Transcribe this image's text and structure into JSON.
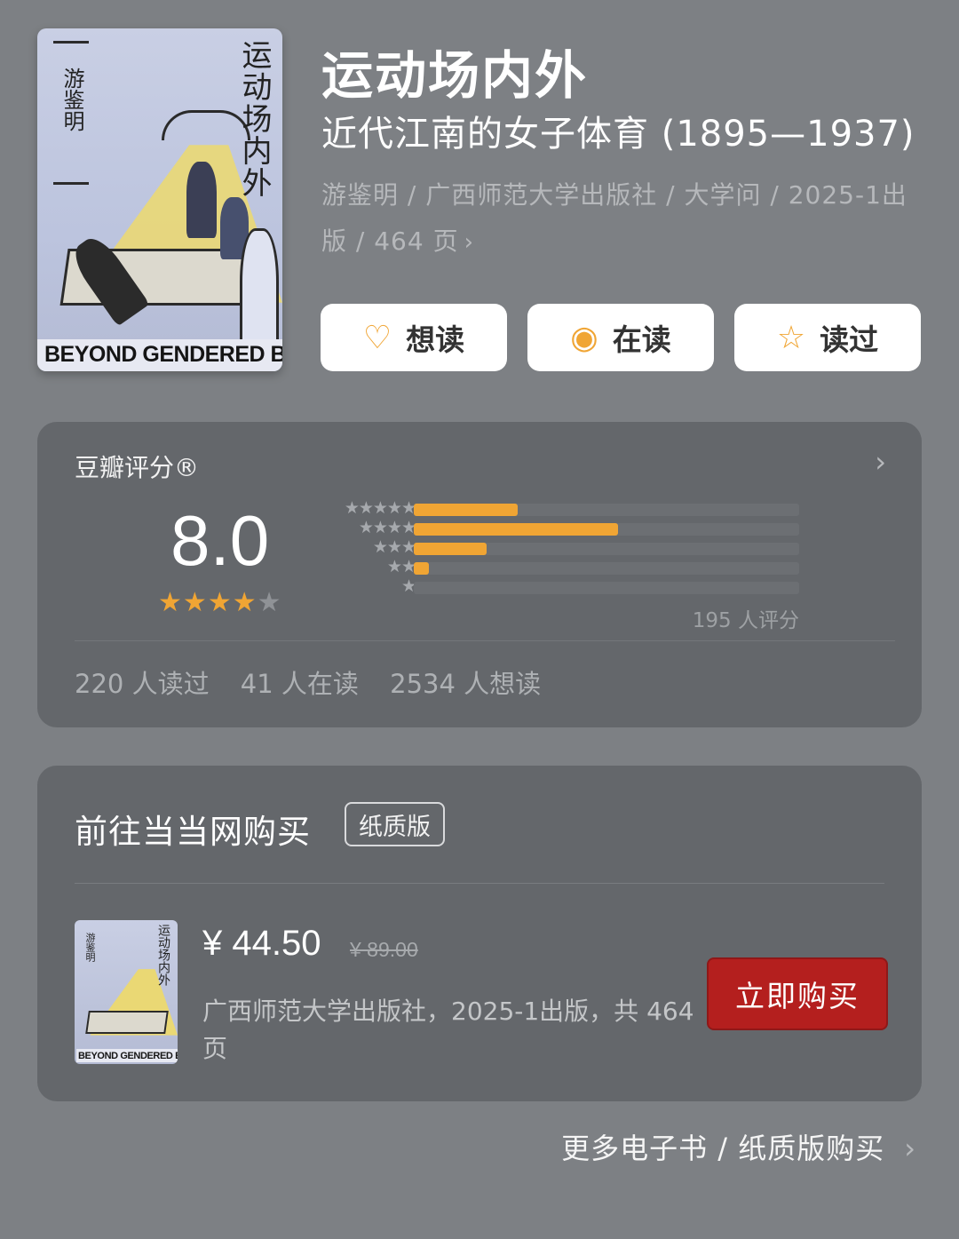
{
  "book": {
    "title": "运动场内外",
    "subtitle": "近代江南的女子体育 (1895—1937)",
    "meta": "游鉴明 / 广西师范大学出版社 / 大学问 / 2025-1出版 / 464 页",
    "cover": {
      "author_vertical": "游鉴明",
      "title_vertical": "运动场内外",
      "english_text": "BEYOND GENDERED BO"
    }
  },
  "actions": {
    "want": {
      "label": "想读",
      "icon": "heart-plus-icon"
    },
    "reading": {
      "label": "在读",
      "icon": "target-icon"
    },
    "read": {
      "label": "读过",
      "icon": "star-outline-icon"
    }
  },
  "rating": {
    "label": "豆瓣评分®",
    "score": "8.0",
    "stars_filled": 4,
    "stars_total": 5,
    "distribution_percent": [
      27,
      53,
      19,
      4,
      0
    ],
    "count_text": "195 人评分",
    "stats": {
      "read": "220 人读过",
      "reading": "41 人在读",
      "want": "2534 人想读"
    },
    "colors": {
      "accent": "#f0a534"
    }
  },
  "purchase": {
    "title": "前往当当网购买",
    "edition": "纸质版",
    "price": "¥ 44.50",
    "original_price": "¥ 89.00",
    "description": "广西师范大学出版社，2025-1出版，共 464页",
    "buy_label": "立即购买",
    "thumb_author": "游鉴明",
    "thumb_title": "运动场内外",
    "thumb_english": "BEYOND GENDERED BO",
    "colors": {
      "button": "#b41f1e"
    }
  },
  "more_link": "更多电子书 / 纸质版购买"
}
